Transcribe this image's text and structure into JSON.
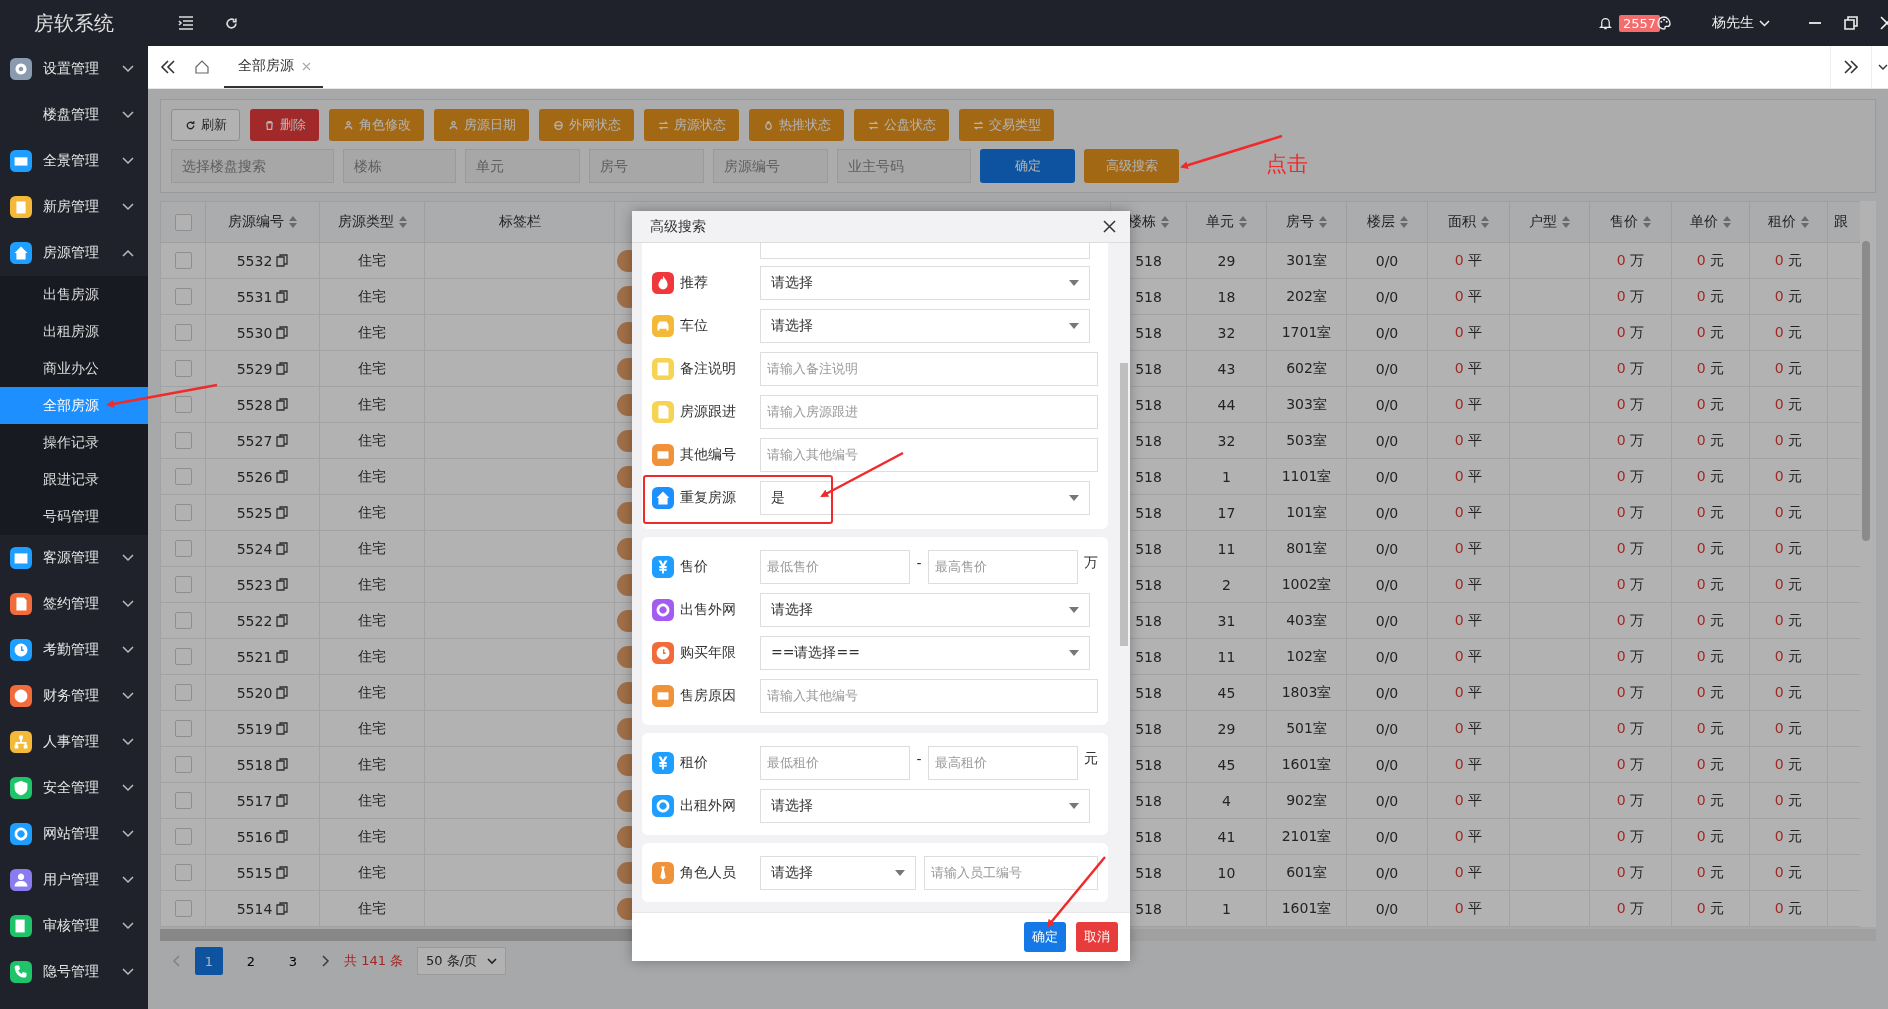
{
  "app_title": "房软系统",
  "topbar": {
    "notification_count": "2557",
    "user": "杨先生"
  },
  "sidebar": {
    "items": [
      {
        "label": "设置管理",
        "color": "#8a9bb0",
        "expanded": false
      },
      {
        "label": "楼盘管理",
        "expanded": false
      },
      {
        "label": "全景管理",
        "color": "#1e9fff",
        "expanded": false
      },
      {
        "label": "新房管理",
        "color": "#f5b93a",
        "expanded": false
      },
      {
        "label": "房源管理",
        "color": "#1e9fff",
        "expanded": true,
        "children": [
          {
            "label": "出售房源",
            "selected": false
          },
          {
            "label": "出租房源",
            "selected": false
          },
          {
            "label": "商业办公",
            "selected": false
          },
          {
            "label": "全部房源",
            "selected": true
          },
          {
            "label": "操作记录",
            "selected": false
          },
          {
            "label": "跟进记录",
            "selected": false
          },
          {
            "label": "号码管理",
            "selected": false
          }
        ]
      },
      {
        "label": "客源管理",
        "color": "#1e9fff",
        "expanded": false
      },
      {
        "label": "签约管理",
        "color": "#f26b3a",
        "expanded": false
      },
      {
        "label": "考勤管理",
        "color": "#1e9fff",
        "expanded": false
      },
      {
        "label": "财务管理",
        "color": "#f26b3a",
        "expanded": false
      },
      {
        "label": "人事管理",
        "color": "#f5b93a",
        "expanded": false
      },
      {
        "label": "安全管理",
        "color": "#1fc46a",
        "expanded": false
      },
      {
        "label": "网站管理",
        "color": "#1e9fff",
        "expanded": false
      },
      {
        "label": "用户管理",
        "color": "#8a7cf0",
        "expanded": false
      },
      {
        "label": "审核管理",
        "color": "#1fc46a",
        "expanded": false
      },
      {
        "label": "隐号管理",
        "color": "#1fc46a",
        "expanded": false
      }
    ]
  },
  "tabs": [
    {
      "label": "全部房源",
      "selected": true
    }
  ],
  "toolbar": [
    {
      "label": "刷新",
      "kind": "default"
    },
    {
      "label": "删除",
      "kind": "danger"
    },
    {
      "label": "角色修改",
      "kind": "warning"
    },
    {
      "label": "房源日期",
      "kind": "warning"
    },
    {
      "label": "外网状态",
      "kind": "warning"
    },
    {
      "label": "房源状态",
      "kind": "warning"
    },
    {
      "label": "热推状态",
      "kind": "warning"
    },
    {
      "label": "公盘状态",
      "kind": "warning"
    },
    {
      "label": "交易类型",
      "kind": "warning"
    }
  ],
  "filters": [
    {
      "placeholder": "选择楼盘搜索"
    },
    {
      "placeholder": "楼栋"
    },
    {
      "placeholder": "单元"
    },
    {
      "placeholder": "房号"
    },
    {
      "placeholder": "房源编号"
    },
    {
      "placeholder": "业主号码"
    }
  ],
  "filter_buttons": [
    {
      "label": "确定",
      "kind": "primary"
    },
    {
      "label": "高级搜索",
      "kind": "warning"
    }
  ],
  "annotation_text": "点击",
  "table": {
    "columns": [
      {
        "kind": "checkbox",
        "checked": false
      },
      {
        "kind": "text",
        "label": "房源编号",
        "sortable": true
      },
      {
        "kind": "text",
        "label": "房源类型",
        "sortable": true
      },
      {
        "kind": "text",
        "label": "标签栏",
        "sortable": false
      },
      {
        "kind": "tag"
      },
      {
        "kind": "text",
        "label": "楼栋",
        "sortable": true
      },
      {
        "kind": "text",
        "label": "单元",
        "sortable": true
      },
      {
        "kind": "text",
        "label": "房号",
        "sortable": true
      },
      {
        "kind": "text",
        "label": "楼层",
        "sortable": true
      },
      {
        "kind": "text",
        "label": "面积",
        "sortable": true
      },
      {
        "kind": "text",
        "label": "户型",
        "sortable": true
      },
      {
        "kind": "text",
        "label": "售价",
        "sortable": true
      },
      {
        "kind": "text",
        "label": "单价",
        "sortable": true
      },
      {
        "kind": "text",
        "label": "租价",
        "sortable": true
      },
      {
        "kind": "text",
        "label": "跟",
        "sortable": false
      }
    ],
    "rows": [
      {
        "checked": false,
        "id": "5532",
        "type": "住宅",
        "building": "518",
        "unit": "29",
        "room": "301室",
        "floor": "0/0",
        "area": [
          "0",
          "平"
        ],
        "sale_price": [
          "0",
          "万"
        ],
        "unit_price": [
          "0",
          "元"
        ],
        "rent": [
          "0",
          "元"
        ]
      },
      {
        "checked": false,
        "id": "5531",
        "type": "住宅",
        "building": "518",
        "unit": "18",
        "room": "202室",
        "floor": "0/0",
        "area": [
          "0",
          "平"
        ],
        "sale_price": [
          "0",
          "万"
        ],
        "unit_price": [
          "0",
          "元"
        ],
        "rent": [
          "0",
          "元"
        ]
      },
      {
        "checked": false,
        "id": "5530",
        "type": "住宅",
        "building": "518",
        "unit": "32",
        "room": "1701室",
        "floor": "0/0",
        "area": [
          "0",
          "平"
        ],
        "sale_price": [
          "0",
          "万"
        ],
        "unit_price": [
          "0",
          "元"
        ],
        "rent": [
          "0",
          "元"
        ]
      },
      {
        "checked": false,
        "id": "5529",
        "type": "住宅",
        "building": "518",
        "unit": "43",
        "room": "602室",
        "floor": "0/0",
        "area": [
          "0",
          "平"
        ],
        "sale_price": [
          "0",
          "万"
        ],
        "unit_price": [
          "0",
          "元"
        ],
        "rent": [
          "0",
          "元"
        ]
      },
      {
        "checked": false,
        "id": "5528",
        "type": "住宅",
        "building": "518",
        "unit": "44",
        "room": "303室",
        "floor": "0/0",
        "area": [
          "0",
          "平"
        ],
        "sale_price": [
          "0",
          "万"
        ],
        "unit_price": [
          "0",
          "元"
        ],
        "rent": [
          "0",
          "元"
        ]
      },
      {
        "checked": false,
        "id": "5527",
        "type": "住宅",
        "building": "518",
        "unit": "32",
        "room": "503室",
        "floor": "0/0",
        "area": [
          "0",
          "平"
        ],
        "sale_price": [
          "0",
          "万"
        ],
        "unit_price": [
          "0",
          "元"
        ],
        "rent": [
          "0",
          "元"
        ]
      },
      {
        "checked": false,
        "id": "5526",
        "type": "住宅",
        "building": "518",
        "unit": "1",
        "room": "1101室",
        "floor": "0/0",
        "area": [
          "0",
          "平"
        ],
        "sale_price": [
          "0",
          "万"
        ],
        "unit_price": [
          "0",
          "元"
        ],
        "rent": [
          "0",
          "元"
        ]
      },
      {
        "checked": false,
        "id": "5525",
        "type": "住宅",
        "building": "518",
        "unit": "17",
        "room": "101室",
        "floor": "0/0",
        "area": [
          "0",
          "平"
        ],
        "sale_price": [
          "0",
          "万"
        ],
        "unit_price": [
          "0",
          "元"
        ],
        "rent": [
          "0",
          "元"
        ]
      },
      {
        "checked": false,
        "id": "5524",
        "type": "住宅",
        "building": "518",
        "unit": "11",
        "room": "801室",
        "floor": "0/0",
        "area": [
          "0",
          "平"
        ],
        "sale_price": [
          "0",
          "万"
        ],
        "unit_price": [
          "0",
          "元"
        ],
        "rent": [
          "0",
          "元"
        ]
      },
      {
        "checked": false,
        "id": "5523",
        "type": "住宅",
        "building": "518",
        "unit": "2",
        "room": "1002室",
        "floor": "0/0",
        "area": [
          "0",
          "平"
        ],
        "sale_price": [
          "0",
          "万"
        ],
        "unit_price": [
          "0",
          "元"
        ],
        "rent": [
          "0",
          "元"
        ]
      },
      {
        "checked": false,
        "id": "5522",
        "type": "住宅",
        "building": "518",
        "unit": "31",
        "room": "403室",
        "floor": "0/0",
        "area": [
          "0",
          "平"
        ],
        "sale_price": [
          "0",
          "万"
        ],
        "unit_price": [
          "0",
          "元"
        ],
        "rent": [
          "0",
          "元"
        ]
      },
      {
        "checked": false,
        "id": "5521",
        "type": "住宅",
        "building": "518",
        "unit": "11",
        "room": "102室",
        "floor": "0/0",
        "area": [
          "0",
          "平"
        ],
        "sale_price": [
          "0",
          "万"
        ],
        "unit_price": [
          "0",
          "元"
        ],
        "rent": [
          "0",
          "元"
        ]
      },
      {
        "checked": false,
        "id": "5520",
        "type": "住宅",
        "building": "518",
        "unit": "45",
        "room": "1803室",
        "floor": "0/0",
        "area": [
          "0",
          "平"
        ],
        "sale_price": [
          "0",
          "万"
        ],
        "unit_price": [
          "0",
          "元"
        ],
        "rent": [
          "0",
          "元"
        ]
      },
      {
        "checked": false,
        "id": "5519",
        "type": "住宅",
        "building": "518",
        "unit": "29",
        "room": "501室",
        "floor": "0/0",
        "area": [
          "0",
          "平"
        ],
        "sale_price": [
          "0",
          "万"
        ],
        "unit_price": [
          "0",
          "元"
        ],
        "rent": [
          "0",
          "元"
        ]
      },
      {
        "checked": false,
        "id": "5518",
        "type": "住宅",
        "building": "518",
        "unit": "45",
        "room": "1601室",
        "floor": "0/0",
        "area": [
          "0",
          "平"
        ],
        "sale_price": [
          "0",
          "万"
        ],
        "unit_price": [
          "0",
          "元"
        ],
        "rent": [
          "0",
          "元"
        ]
      },
      {
        "checked": false,
        "id": "5517",
        "type": "住宅",
        "building": "518",
        "unit": "4",
        "room": "902室",
        "floor": "0/0",
        "area": [
          "0",
          "平"
        ],
        "sale_price": [
          "0",
          "万"
        ],
        "unit_price": [
          "0",
          "元"
        ],
        "rent": [
          "0",
          "元"
        ]
      },
      {
        "checked": false,
        "id": "5516",
        "type": "住宅",
        "building": "518",
        "unit": "41",
        "room": "2101室",
        "floor": "0/0",
        "area": [
          "0",
          "平"
        ],
        "sale_price": [
          "0",
          "万"
        ],
        "unit_price": [
          "0",
          "元"
        ],
        "rent": [
          "0",
          "元"
        ]
      },
      {
        "checked": false,
        "id": "5515",
        "type": "住宅",
        "building": "518",
        "unit": "10",
        "room": "601室",
        "floor": "0/0",
        "area": [
          "0",
          "平"
        ],
        "sale_price": [
          "0",
          "万"
        ],
        "unit_price": [
          "0",
          "元"
        ],
        "rent": [
          "0",
          "元"
        ]
      },
      {
        "checked": false,
        "id": "5514",
        "type": "住宅",
        "building": "518",
        "unit": "1",
        "room": "1601室",
        "floor": "0/0",
        "area": [
          "0",
          "平"
        ],
        "sale_price": [
          "0",
          "万"
        ],
        "unit_price": [
          "0",
          "元"
        ],
        "rent": [
          "0",
          "元"
        ]
      }
    ]
  },
  "pagination": {
    "pages": [
      {
        "label": "1",
        "selected": true
      },
      {
        "label": "2",
        "selected": false
      },
      {
        "label": "3",
        "selected": false
      }
    ],
    "total": "共 141 条",
    "page_size": "50 条/页"
  },
  "advanced_search": {
    "title": "高级搜索",
    "sections": [
      {
        "fields": [
          {
            "kind": "select",
            "label": "推荐",
            "color": "#f0383c",
            "value": "请选择"
          },
          {
            "kind": "select",
            "label": "车位",
            "color": "#f5b93a",
            "value": "请选择"
          },
          {
            "kind": "input",
            "label": "备注说明",
            "color": "#f7d354",
            "placeholder": "请输入备注说明"
          },
          {
            "kind": "input",
            "label": "房源跟进",
            "color": "#f7d354",
            "placeholder": "请输入房源跟进"
          },
          {
            "kind": "input",
            "label": "其他编号",
            "color": "#f0923a",
            "placeholder": "请输入其他编号"
          },
          {
            "kind": "select",
            "label": "重复房源",
            "color": "#1e8fff",
            "value": "是"
          }
        ]
      },
      {
        "fields": [
          {
            "kind": "range",
            "label": "售价",
            "color": "#1e9fff",
            "min_placeholder": "最低售价",
            "separator": "-",
            "max_placeholder": "最高售价",
            "unit": "万"
          },
          {
            "kind": "select",
            "label": "出售外网",
            "color": "#a45cf0",
            "value": "请选择"
          },
          {
            "kind": "select",
            "label": "购买年限",
            "color": "#f26b3a",
            "value": "==请选择=="
          },
          {
            "kind": "input",
            "label": "售房原因",
            "color": "#f0923a",
            "placeholder": "请输入其他编号"
          }
        ]
      },
      {
        "fields": [
          {
            "kind": "range",
            "label": "租价",
            "color": "#1e9fff",
            "min_placeholder": "最低租价",
            "separator": "-",
            "max_placeholder": "最高租价",
            "unit": "元"
          },
          {
            "kind": "select",
            "label": "出租外网",
            "color": "#1e9fff",
            "value": "请选择"
          }
        ]
      },
      {
        "fields": [
          {
            "kind": "select_input",
            "label": "角色人员",
            "color": "#f0923a",
            "value": "请选择",
            "placeholder": "请输入员工编号"
          }
        ]
      }
    ],
    "confirm": "确定",
    "cancel": "取消"
  }
}
